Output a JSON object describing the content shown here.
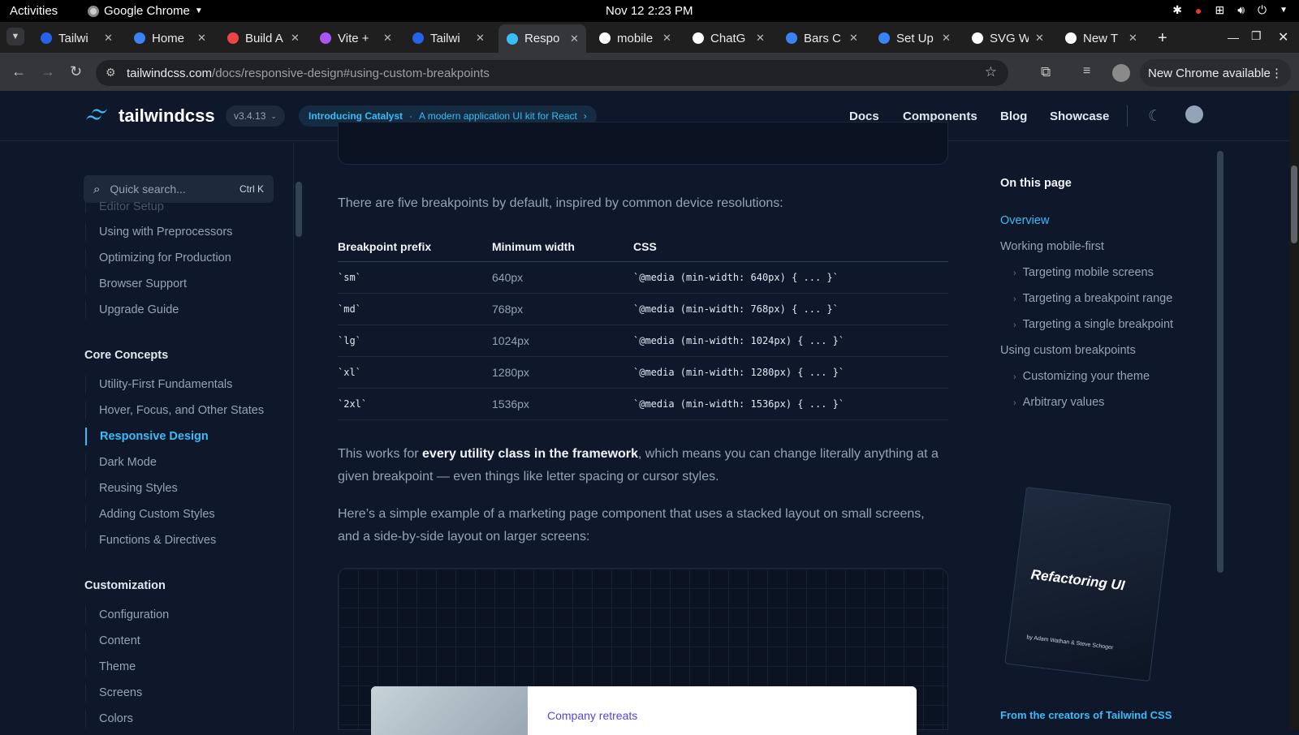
{
  "os": {
    "activities": "Activities",
    "app_name": "Google Chrome",
    "clock": "Nov 12  2:23 PM"
  },
  "browser": {
    "tabs": [
      {
        "title": "Tailwi",
        "color": "#2563eb"
      },
      {
        "title": "Home",
        "color": "#3b82f6"
      },
      {
        "title": "Build A",
        "color": "#ef4444"
      },
      {
        "title": "Vite +",
        "color": "#a855f7"
      },
      {
        "title": "Tailwi",
        "color": "#2563eb"
      },
      {
        "title": "Respo",
        "color": "#38bdf8",
        "active": true
      },
      {
        "title": "mobile",
        "color": "#ffffff"
      },
      {
        "title": "ChatG",
        "color": "#ffffff"
      },
      {
        "title": "Bars C",
        "color": "#3b82f6"
      },
      {
        "title": "Set Up",
        "color": "#3b82f6"
      },
      {
        "title": "SVG W",
        "color": "#ffffff"
      },
      {
        "title": "New T",
        "color": "#ffffff"
      }
    ],
    "url_host": "tailwindcss.com",
    "url_path": "/docs/responsive-design#using-custom-breakpoints",
    "update_label": "New Chrome available"
  },
  "site": {
    "logo_text": "tailwindcss",
    "version": "v3.4.13",
    "promo_title": "Introducing Catalyst",
    "promo_sep": "·",
    "promo_text": "A modern application UI kit for React",
    "nav": [
      "Docs",
      "Components",
      "Blog",
      "Showcase"
    ]
  },
  "sidebar": {
    "search_placeholder": "Quick search...",
    "search_shortcut": "Ctrl K",
    "partial_item": "Editor Setup",
    "getting_started": [
      "Using with Preprocessors",
      "Optimizing for Production",
      "Browser Support",
      "Upgrade Guide"
    ],
    "core_title": "Core Concepts",
    "core": [
      "Utility-First Fundamentals",
      "Hover, Focus, and Other States",
      "Responsive Design",
      "Dark Mode",
      "Reusing Styles",
      "Adding Custom Styles",
      "Functions & Directives"
    ],
    "customization_title": "Customization",
    "customization": [
      "Configuration",
      "Content",
      "Theme",
      "Screens",
      "Colors"
    ]
  },
  "main": {
    "intro": "There are five breakpoints by default, inspired by common device resolutions:",
    "table_headers": [
      "Breakpoint prefix",
      "Minimum width",
      "CSS"
    ],
    "table_rows": [
      [
        "`sm`",
        "640px",
        "`@media (min-width: 640px) { ... }`"
      ],
      [
        "`md`",
        "768px",
        "`@media (min-width: 768px) { ... }`"
      ],
      [
        "`lg`",
        "1024px",
        "`@media (min-width: 1024px) { ... }`"
      ],
      [
        "`xl`",
        "1280px",
        "`@media (min-width: 1280px) { ... }`"
      ],
      [
        "`2xl`",
        "1536px",
        "`@media (min-width: 1536px) { ... }`"
      ]
    ],
    "p1_start": "This works for ",
    "p1_bold": "every utility class in the framework",
    "p1_end": ", which means you can change literally anything at a given breakpoint — even things like letter spacing or cursor styles.",
    "p2": "Here’s a simple example of a marketing page component that uses a stacked layout on small screens, and a side-by-side layout on larger screens:",
    "card_label": "Company retreats"
  },
  "toc": {
    "title": "On this page",
    "items": [
      {
        "label": "Overview",
        "active": true,
        "sub": false
      },
      {
        "label": "Working mobile-first",
        "sub": false
      },
      {
        "label": "Targeting mobile screens",
        "sub": true
      },
      {
        "label": "Targeting a breakpoint range",
        "sub": true
      },
      {
        "label": "Targeting a single breakpoint",
        "sub": true
      },
      {
        "label": "Using custom breakpoints",
        "sub": false
      },
      {
        "label": "Customizing your theme",
        "sub": true
      },
      {
        "label": "Arbitrary values",
        "sub": true
      }
    ],
    "book_title": "Refactoring UI",
    "book_authors": "by Adam Wathan & Steve Schoger",
    "creators": "From the creators of Tailwind CSS"
  }
}
